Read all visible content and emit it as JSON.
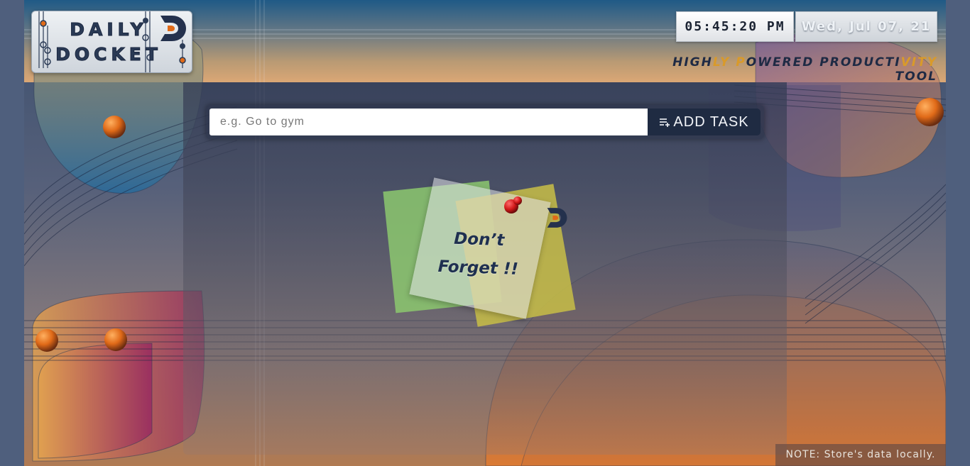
{
  "header": {
    "logo": {
      "line1": "DAILY",
      "line2": "DOCKET"
    },
    "clock": "05:45:20 PM",
    "date": "Wed, Jul 07, 21",
    "tagline": "HIGHLY POWERED PRODUCTIVITY TOOL"
  },
  "task_form": {
    "placeholder": "e.g. Go to gym",
    "value": "",
    "add_button_label": "ADD TASK",
    "add_button_icon": "playlist-add-icon"
  },
  "empty_state": {
    "line1": "Don’t",
    "line2": "Forget !!",
    "pin_icon": "push-pin-icon"
  },
  "footer": {
    "note": "NOTE: Store's data locally."
  },
  "colors": {
    "accent_orange": "#e07020",
    "navy": "#1f2b42",
    "tagline_highlight": "#d99a2a"
  }
}
